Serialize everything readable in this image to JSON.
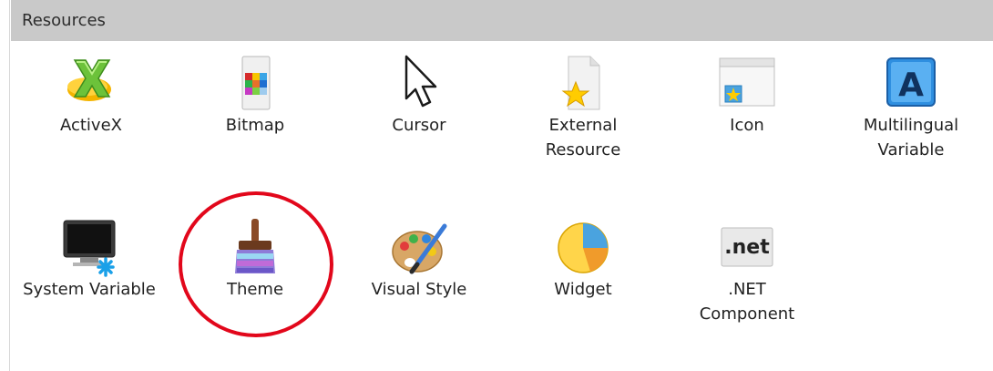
{
  "panel": {
    "title": "Resources"
  },
  "items": [
    {
      "label": "ActiveX",
      "icon": "activex-icon"
    },
    {
      "label": "Bitmap",
      "icon": "bitmap-icon"
    },
    {
      "label": "Cursor",
      "icon": "cursor-icon"
    },
    {
      "label": "External\nResource",
      "icon": "external-resource-icon"
    },
    {
      "label": "Icon",
      "icon": "icon-resource-icon"
    },
    {
      "label": "Multilingual\nVariable",
      "icon": "multilingual-variable-icon"
    },
    {
      "label": "System Variable",
      "icon": "system-variable-icon"
    },
    {
      "label": "Theme",
      "icon": "theme-brush-icon"
    },
    {
      "label": "Visual Style",
      "icon": "palette-icon"
    },
    {
      "label": "Widget",
      "icon": "widget-pie-icon"
    },
    {
      "label": ".NET\nComponent",
      "icon": "dotnet-icon"
    }
  ],
  "highlight": {
    "color": "#e2071b",
    "target": "Theme"
  }
}
